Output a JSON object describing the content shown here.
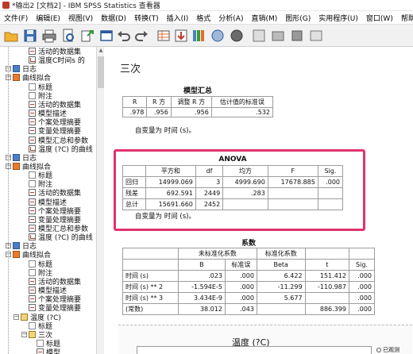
{
  "window": {
    "title": "*输出2 [文档2] - IBM SPSS Statistics 查看器"
  },
  "menu": [
    "文件(F)",
    "编辑(E)",
    "视图(V)",
    "数据(D)",
    "转换(T)",
    "插入(I)",
    "格式",
    "分析(A)",
    "直销(M)",
    "图形(G)",
    "实用程序(U)",
    "窗口(W)",
    "帮助"
  ],
  "toolbar_icons": [
    "open-folder-icon",
    "save-icon",
    "print-icon",
    "print-preview-icon",
    "export-icon",
    "recall-dialog-icon",
    "undo-icon",
    "redo-icon",
    "goto-data-icon",
    "goto-case-icon",
    "goto-variable-icon",
    "variables-icon",
    "show-all-icon",
    "hide-icon",
    "promote-icon",
    "demote-icon"
  ],
  "nav": {
    "items": [
      {
        "label": "活动的数据集",
        "icon": "table",
        "indent": 3
      },
      {
        "label": "温度C时间s 的",
        "icon": "chart",
        "indent": 3
      },
      {
        "label": "日志",
        "icon": "log",
        "indent": 1
      },
      {
        "label": "曲线拟合",
        "icon": "curve",
        "indent": 1
      },
      {
        "label": "标题",
        "icon": "doc",
        "indent": 3
      },
      {
        "label": "附注",
        "icon": "doc",
        "indent": 3
      },
      {
        "label": "活动的数据集",
        "icon": "table",
        "indent": 3
      },
      {
        "label": "模型描述",
        "icon": "table",
        "indent": 3
      },
      {
        "label": "个案处理摘要",
        "icon": "table",
        "indent": 3
      },
      {
        "label": "变量处理摘要",
        "icon": "table",
        "indent": 3
      },
      {
        "label": "模型汇总和参数",
        "icon": "table",
        "indent": 3
      },
      {
        "label": "温度 (?C) 的曲线",
        "icon": "chart",
        "indent": 3
      },
      {
        "label": "日志",
        "icon": "log",
        "indent": 1
      },
      {
        "label": "曲线拟合",
        "icon": "curve",
        "indent": 1
      },
      {
        "label": "标题",
        "icon": "doc",
        "indent": 3
      },
      {
        "label": "附注",
        "icon": "doc",
        "indent": 3
      },
      {
        "label": "活动的数据集",
        "icon": "table",
        "indent": 3
      },
      {
        "label": "模型描述",
        "icon": "table",
        "indent": 3
      },
      {
        "label": "个案处理摘要",
        "icon": "table",
        "indent": 3
      },
      {
        "label": "变量处理摘要",
        "icon": "table",
        "indent": 3
      },
      {
        "label": "模型汇总和参数",
        "icon": "table",
        "indent": 3
      },
      {
        "label": "温度 (?C) 的曲线",
        "icon": "chart",
        "indent": 3
      },
      {
        "label": "日志",
        "icon": "log",
        "indent": 1
      },
      {
        "label": "曲线拟合",
        "icon": "curve",
        "indent": 1
      },
      {
        "label": "标题",
        "icon": "doc",
        "indent": 3
      },
      {
        "label": "附注",
        "icon": "doc",
        "indent": 3
      },
      {
        "label": "活动的数据集",
        "icon": "table",
        "indent": 3
      },
      {
        "label": "模型描述",
        "icon": "table",
        "indent": 3
      },
      {
        "label": "个案处理摘要",
        "icon": "table",
        "indent": 3
      },
      {
        "label": "变量处理摘要",
        "icon": "table",
        "indent": 3
      },
      {
        "label": "温度 (?C)",
        "icon": "book",
        "indent": 2
      },
      {
        "label": "标题",
        "icon": "doc",
        "indent": 3
      },
      {
        "label": "三次",
        "icon": "book",
        "indent": 3
      },
      {
        "label": "标题",
        "icon": "doc",
        "indent": 4
      },
      {
        "label": "模型",
        "icon": "table",
        "indent": 4
      }
    ]
  },
  "output": {
    "section_heading": "三次",
    "model_summary": {
      "title": "模型汇总",
      "headers": [
        "R",
        "R 方",
        "调整 R 方",
        "估计值的标准误"
      ],
      "row": [
        ".978",
        ".956",
        ".956",
        ".532"
      ],
      "footnote": "自变量为 时间 (s)。"
    },
    "anova": {
      "title": "ANOVA",
      "headers": [
        "",
        "平方和",
        "df",
        "均方",
        "F",
        "Sig."
      ],
      "rows": [
        [
          "回归",
          "14999.069",
          "3",
          "4999.690",
          "17678.885",
          ".000"
        ],
        [
          "残差",
          "692.591",
          "2449",
          ".283",
          "",
          ""
        ],
        [
          "总计",
          "15691.660",
          "2452",
          "",
          "",
          ""
        ]
      ],
      "footnote": "自变量为 时间 (s)。"
    },
    "coefficients": {
      "title": "系数",
      "group_headers": [
        "未标准化系数",
        "标准化系数"
      ],
      "headers": [
        "",
        "B",
        "标准误",
        "Beta",
        "t",
        "Sig."
      ],
      "rows": [
        [
          "时间 (s)",
          ".023",
          ".000",
          "6.422",
          "151.412",
          ".000"
        ],
        [
          "时间 (s) ** 2",
          "-1.594E-5",
          ".000",
          "-11.299",
          "-110.987",
          ".000"
        ],
        [
          "时间 (s) ** 3",
          "3.434E-9",
          ".000",
          "5.677",
          "",
          ".000"
        ],
        [
          "(常数)",
          "38.012",
          ".043",
          "",
          "886.399",
          ".000"
        ]
      ]
    },
    "chart_title": "温度 (?C)",
    "legend_label": "已观测"
  }
}
